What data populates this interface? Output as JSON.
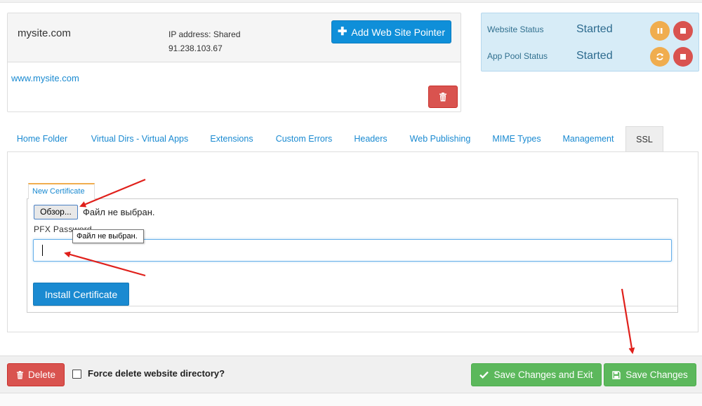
{
  "site": {
    "name": "mysite.com",
    "ip_label": "IP address: Shared",
    "ip_value": "91.238.103.67",
    "add_pointer_label": "Add Web Site Pointer",
    "link": "www.mysite.com"
  },
  "status": {
    "website_label": "Website Status",
    "website_value": "Started",
    "apppool_label": "App Pool Status",
    "apppool_value": "Started"
  },
  "tabs": [
    {
      "label": "Home Folder"
    },
    {
      "label": "Virtual Dirs - Virtual Apps"
    },
    {
      "label": "Extensions"
    },
    {
      "label": "Custom Errors"
    },
    {
      "label": "Headers"
    },
    {
      "label": "Web Publishing"
    },
    {
      "label": "MIME Types"
    },
    {
      "label": "Management"
    },
    {
      "label": "SSL"
    }
  ],
  "active_tab": "SSL",
  "ssl": {
    "subtab_label": "New Certificate",
    "file_button_label": "Обзор...",
    "file_status": "Файл не выбран.",
    "pfx_label": "PFX Password",
    "tooltip": "Файл не выбран.",
    "password_value": "",
    "install_label": "Install Certificate"
  },
  "footer": {
    "delete_label": "Delete",
    "force_delete_label": "Force delete website directory?",
    "force_delete_checked": false,
    "save_exit_label": "Save Changes and Exit",
    "save_label": "Save Changes"
  },
  "colors": {
    "primary": "#0f8fd9",
    "danger": "#d9534f",
    "success": "#5cb85c",
    "warning": "#f0ad4e",
    "info_bg": "#d7ecf7",
    "annotation_arrow": "#e0201b"
  },
  "icons": {
    "add_pointer": "plus-icon",
    "delete_site_pointer": "trash-icon",
    "pause": "pause-icon",
    "stop": "stop-icon",
    "recycle": "refresh-icon",
    "delete": "trash-icon",
    "save_exit": "check-icon",
    "save": "floppy-disk-icon"
  }
}
